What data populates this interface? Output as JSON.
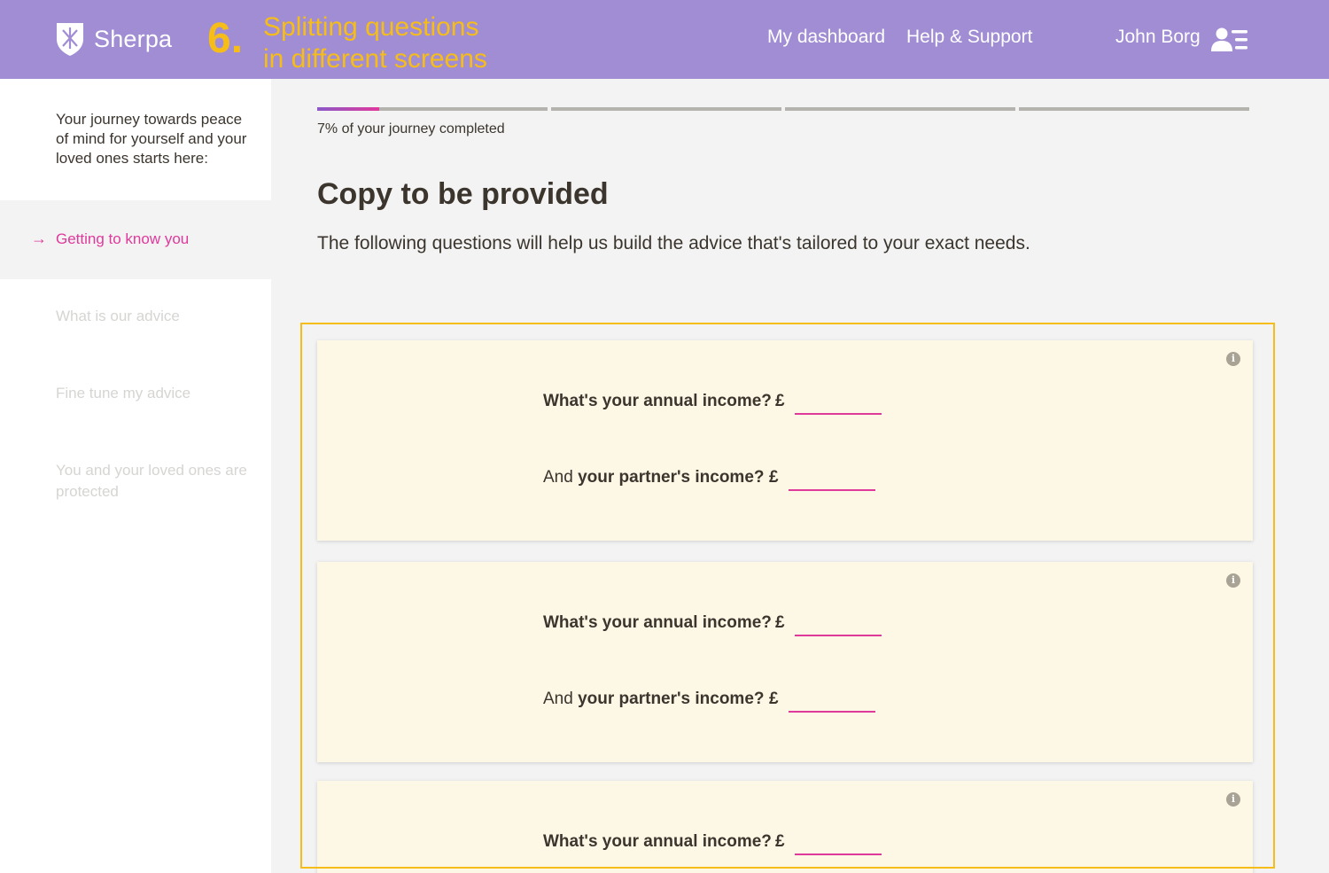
{
  "header": {
    "brand": "Sherpa",
    "step_number": "6.",
    "step_title_line1": "Splitting questions",
    "step_title_line2": "in different screens",
    "nav_dashboard": "My dashboard",
    "nav_help": "Help & Support",
    "user_name": "John Borg",
    "colors": {
      "header_bg": "#a18dd4",
      "accent_yellow": "#f6bd18"
    }
  },
  "sidebar": {
    "intro": "Your journey towards peace of mind for yourself and your loved ones starts here:",
    "active_item": "Getting to know you",
    "items": [
      "What is our advice",
      "Fine tune my advice",
      "You and your loved ones are protected"
    ],
    "colors": {
      "active": "#e0399c",
      "inactive": "#d7d5d2"
    }
  },
  "main": {
    "progress_percent": 7,
    "progress_segments": 4,
    "progress_text": "7% of your journey completed",
    "title": "Copy to be provided",
    "description": "The following questions will help us build the advice that's tailored to your exact needs.",
    "cards": [
      {
        "q1": "What's your annual income?",
        "q2_prefix": "And",
        "q2": "your partner's income?",
        "currency": "£",
        "value1": "",
        "value2": ""
      },
      {
        "q1": "What's your annual income?",
        "q2_prefix": "And",
        "q2": "your partner's income?",
        "currency": "£",
        "value1": "",
        "value2": ""
      },
      {
        "q1": "What's your annual income?",
        "currency": "£",
        "value1": ""
      }
    ],
    "colors": {
      "input_underline": "#e0399c",
      "card_bg": "#fdf7e5",
      "highlight": "#f6bd18"
    }
  }
}
